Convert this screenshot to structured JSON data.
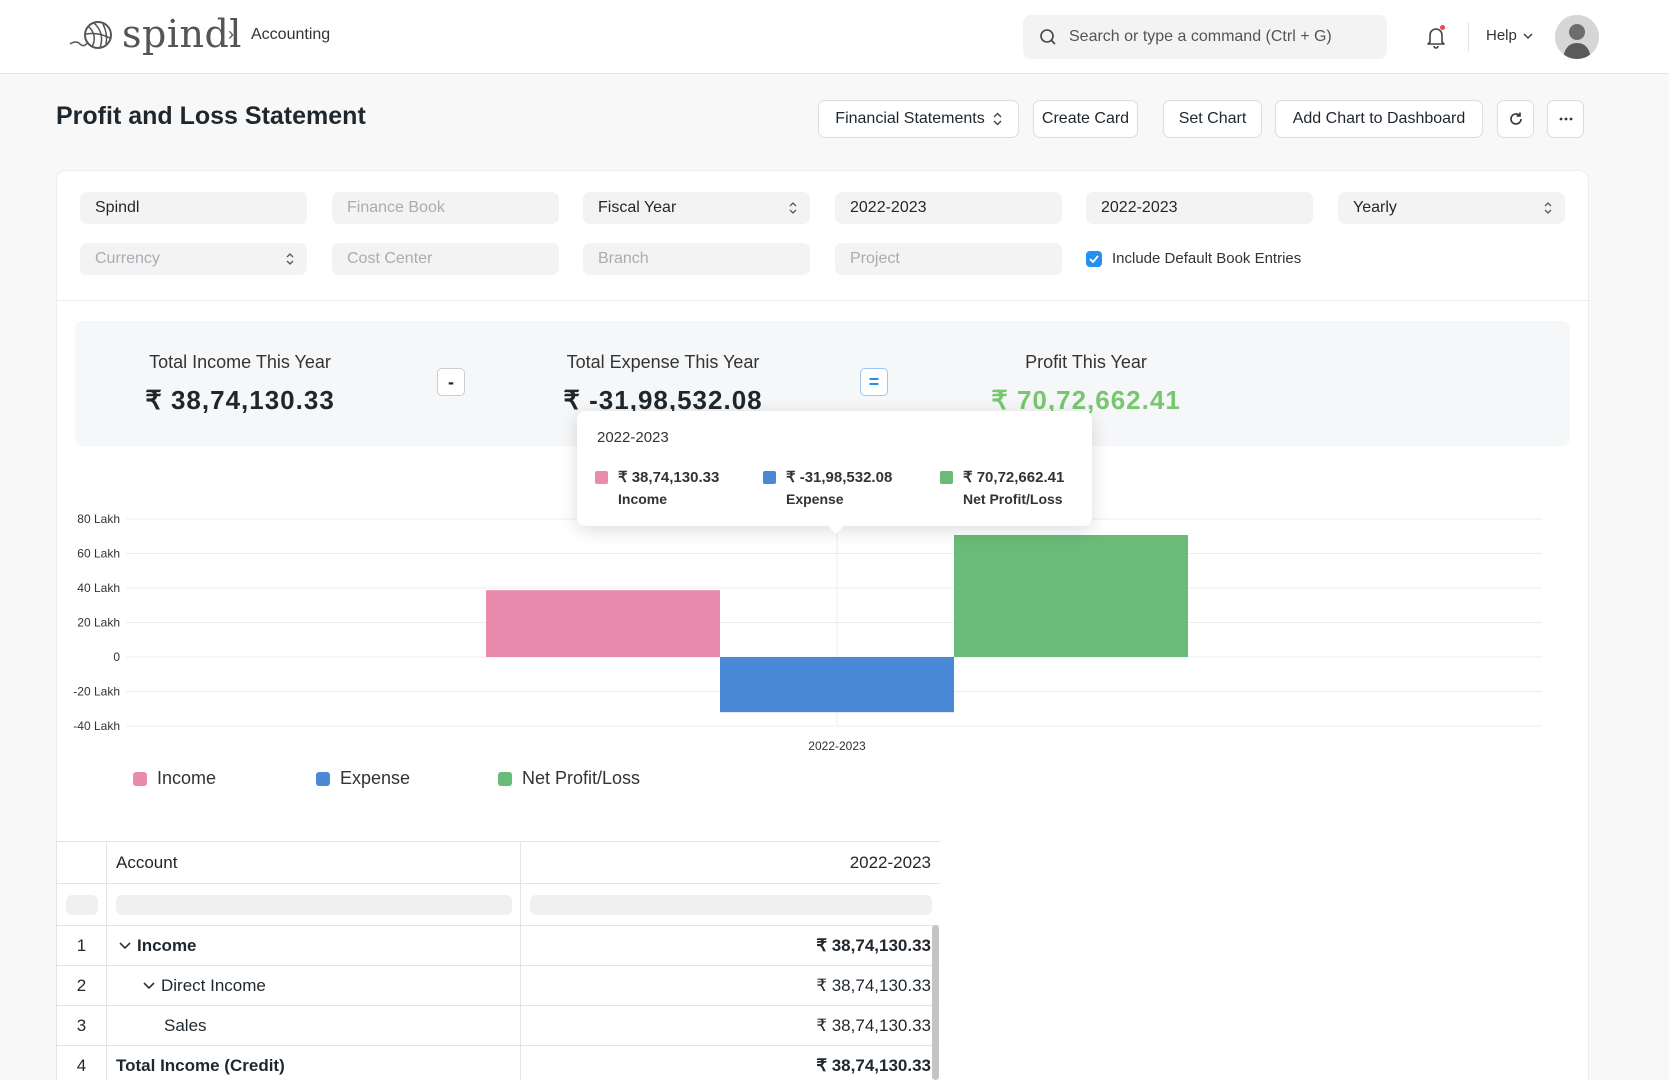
{
  "navbar": {
    "logo_text": "spindl",
    "breadcrumb": "Accounting",
    "search_placeholder": "Search or type a command (Ctrl + G)",
    "help_label": "Help"
  },
  "header": {
    "title": "Profit and Loss Statement",
    "buttons": {
      "financial_statements": "Financial Statements",
      "create_card": "Create Card",
      "set_chart": "Set Chart",
      "add_chart": "Add Chart to Dashboard"
    }
  },
  "filters": {
    "company": "Spindl",
    "finance_book": "Finance Book",
    "filter_based_on": "Fiscal Year",
    "from_fiscal_year": "2022-2023",
    "to_fiscal_year": "2022-2023",
    "periodicity": "Yearly",
    "currency": "Currency",
    "cost_center": "Cost Center",
    "branch": "Branch",
    "project": "Project",
    "include_default_book": "Include Default Book Entries"
  },
  "summary": {
    "income_label": "Total Income This Year",
    "income_value": "₹ 38,74,130.33",
    "minus": "-",
    "expense_label": "Total Expense This Year",
    "expense_value": "₹ -31,98,532.08",
    "equals": "=",
    "profit_label": "Profit This Year",
    "profit_value": "₹ 70,72,662.41"
  },
  "chart_data": {
    "type": "bar",
    "categories": [
      "2022-2023"
    ],
    "series": [
      {
        "name": "Income",
        "values": [
          3874130.33
        ],
        "color": "#e88bad"
      },
      {
        "name": "Expense",
        "values": [
          -3198532.08
        ],
        "color": "#4a89d6"
      },
      {
        "name": "Net Profit/Loss",
        "values": [
          7072662.41
        ],
        "color": "#6aba78"
      }
    ],
    "y_ticks": [
      "80 Lakh",
      "60 Lakh",
      "40 Lakh",
      "20 Lakh",
      "0",
      "-20 Lakh",
      "-40 Lakh"
    ],
    "ylim": [
      -4000000,
      8000000
    ],
    "grid": true,
    "legend": "bottom-left"
  },
  "tooltip": {
    "title": "2022-2023",
    "items": [
      {
        "value": "₹ 38,74,130.33",
        "name": "Income"
      },
      {
        "value": "₹ -31,98,532.08",
        "name": "Expense"
      },
      {
        "value": "₹ 70,72,662.41",
        "name": "Net Profit/Loss"
      }
    ]
  },
  "legend": [
    "Income",
    "Expense",
    "Net Profit/Loss"
  ],
  "table": {
    "headers": {
      "account": "Account",
      "period": "2022-2023"
    },
    "rows": [
      {
        "num": "1",
        "account": "Income",
        "value": "₹ 38,74,130.33"
      },
      {
        "num": "2",
        "account": "Direct Income",
        "value": "₹ 38,74,130.33"
      },
      {
        "num": "3",
        "account": "Sales",
        "value": "₹ 38,74,130.33"
      },
      {
        "num": "4",
        "account": "Total Income (Credit)",
        "value": "₹ 38,74,130.33"
      }
    ]
  },
  "colors": {
    "accent": "#2490ef",
    "profit": "#78c66f",
    "income": "#e88bad",
    "expense": "#4a89d6",
    "net": "#6aba78"
  }
}
